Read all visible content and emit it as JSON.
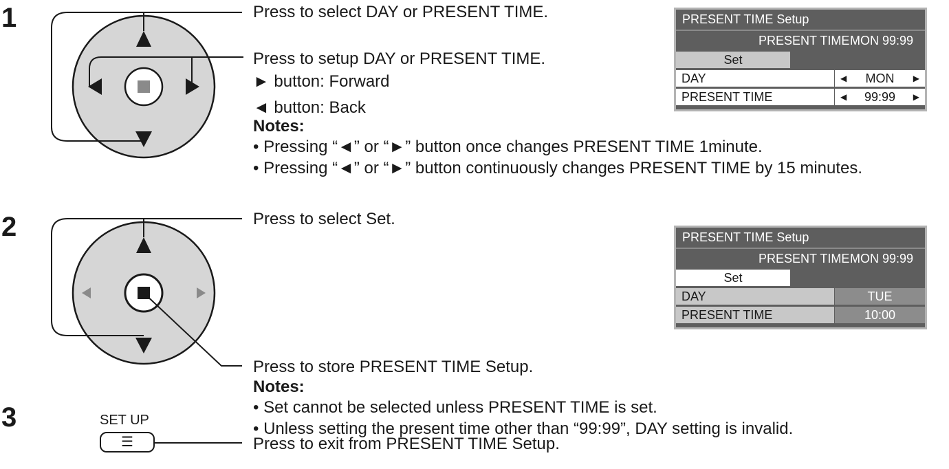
{
  "steps": [
    {
      "number": "1",
      "instructions": {
        "select": "Press to select DAY or PRESENT TIME.",
        "setup": "Press to setup DAY or PRESENT TIME.",
        "forward": "► button: Forward",
        "back": "◄ button: Back"
      },
      "notes_heading": "Notes:",
      "notes": [
        "• Pressing “◄” or “►” button once changes PRESENT TIME 1minute.",
        "• Pressing “◄” or “►” button continuously changes PRESENT TIME by 15 minutes."
      ],
      "menu": {
        "title": "PRESENT  TIME Setup",
        "info_label": "PRESENT  TIME",
        "info_value": "MON  99:99",
        "set_label": "Set",
        "rows": [
          {
            "label": "DAY",
            "value": "MON"
          },
          {
            "label": "PRESENT  TIME",
            "value": "99:99"
          }
        ]
      }
    },
    {
      "number": "2",
      "instructions": {
        "select": "Press to select Set.",
        "store": "Press to store PRESENT TIME Setup."
      },
      "notes_heading": "Notes:",
      "notes": [
        "• Set cannot be selected unless PRESENT TIME is set.",
        "• Unless setting the present time other than “99:99”, DAY setting is invalid."
      ],
      "menu": {
        "title": "PRESENT  TIME Setup",
        "info_label": "PRESENT  TIME",
        "info_value": "MON  99:99",
        "set_label": "Set",
        "rows": [
          {
            "label": "DAY",
            "value": "TUE"
          },
          {
            "label": "PRESENT  TIME",
            "value": "10:00"
          }
        ]
      }
    },
    {
      "number": "3",
      "key_label": "SET UP",
      "instructions": {
        "exit": "Press to exit from PRESENT TIME Setup."
      }
    }
  ],
  "icons": {
    "dpad": "directional-pad-icon",
    "menu_key": "menu-list-icon",
    "arrow_left": "◀",
    "arrow_right": "▶",
    "menu_glyph": "☰"
  }
}
